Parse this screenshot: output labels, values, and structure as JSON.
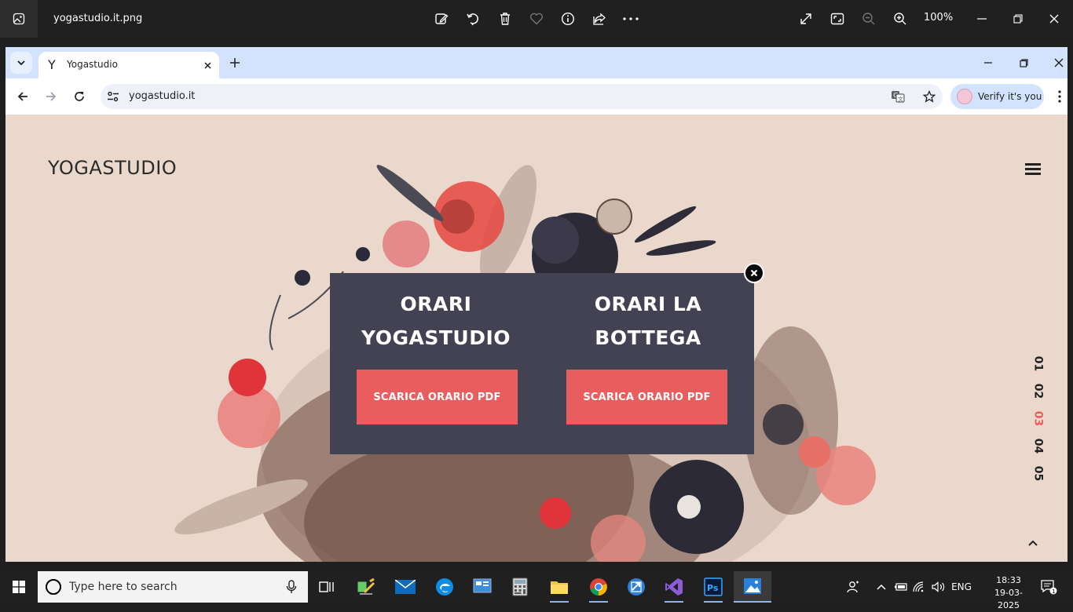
{
  "viewer": {
    "file_name": "yogastudio.it.png",
    "zoom": "100%"
  },
  "browser": {
    "tab_title": "Yogastudio",
    "tab_favicon": "Y",
    "url": "yogastudio.it",
    "verify_label": "Verify it's you"
  },
  "site": {
    "logo": "YOGASTUDIO",
    "slides": [
      "01",
      "02",
      "03",
      "04",
      "05"
    ],
    "active_slide": "03"
  },
  "modal": {
    "col1_heading_line1": "ORARI",
    "col1_heading_line2": "YOGASTUDIO",
    "col2_heading_line1": "ORARI LA",
    "col2_heading_line2": "BOTTEGA",
    "button1_label": "SCARICA ORARIO PDF",
    "button2_label": "SCARICA ORARIO PDF"
  },
  "taskbar": {
    "search_placeholder": "Type here to search",
    "language": "ENG",
    "time": "18:33",
    "date": "19-03-2025",
    "notification_count": "1"
  },
  "colors": {
    "accent": "#e95d5e",
    "modal_bg": "#434252",
    "page_bg": "#ead8cc"
  }
}
